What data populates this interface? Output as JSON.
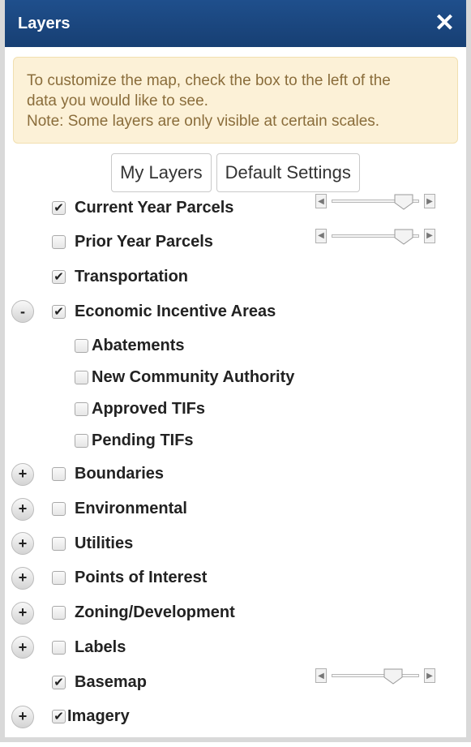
{
  "header": {
    "title": "Layers",
    "close_symbol": "✕"
  },
  "notice": {
    "line1": "To customize the map, check the box to the left of the",
    "line2": "data you would like to see.",
    "line3": "Note: Some layers are only visible at certain scales."
  },
  "buttons": {
    "my_layers": "My Layers",
    "default_settings": "Default Settings"
  },
  "layers": [
    {
      "label": "Current Year Parcels",
      "checked": true,
      "toggle": "",
      "has_slider": true,
      "slider_value": 0.82
    },
    {
      "label": "Prior Year Parcels",
      "checked": false,
      "toggle": "",
      "has_slider": true,
      "slider_value": 0.82
    },
    {
      "label": "Transportation",
      "checked": true,
      "toggle": ""
    },
    {
      "label": "Economic Incentive Areas",
      "checked": true,
      "toggle": "-"
    },
    {
      "label": "Abatements",
      "checked": false,
      "sub": true
    },
    {
      "label": "New Community Authority",
      "checked": false,
      "sub": true
    },
    {
      "label": "Approved TIFs",
      "checked": false,
      "sub": true
    },
    {
      "label": "Pending TIFs",
      "checked": false,
      "sub": true
    },
    {
      "label": "Boundaries",
      "checked": false,
      "toggle": "+"
    },
    {
      "label": "Environmental",
      "checked": false,
      "toggle": "+"
    },
    {
      "label": "Utilities",
      "checked": false,
      "toggle": "+"
    },
    {
      "label": "Points of Interest",
      "checked": false,
      "toggle": "+"
    },
    {
      "label": "Zoning/Development",
      "checked": false,
      "toggle": "+"
    },
    {
      "label": "Labels",
      "checked": false,
      "toggle": "+"
    },
    {
      "label": "Basemap",
      "checked": true,
      "toggle": "",
      "has_slider": true,
      "slider_value": 0.7
    },
    {
      "label": "Imagery",
      "checked": true,
      "toggle": "+",
      "tight": true
    }
  ],
  "icons": {
    "check": "✔",
    "slider_left": "◀",
    "slider_right": "▶"
  },
  "colors": {
    "header": "#1f4f8c",
    "notice_bg": "#fcf1d7",
    "notice_text": "#8a6d3b"
  }
}
